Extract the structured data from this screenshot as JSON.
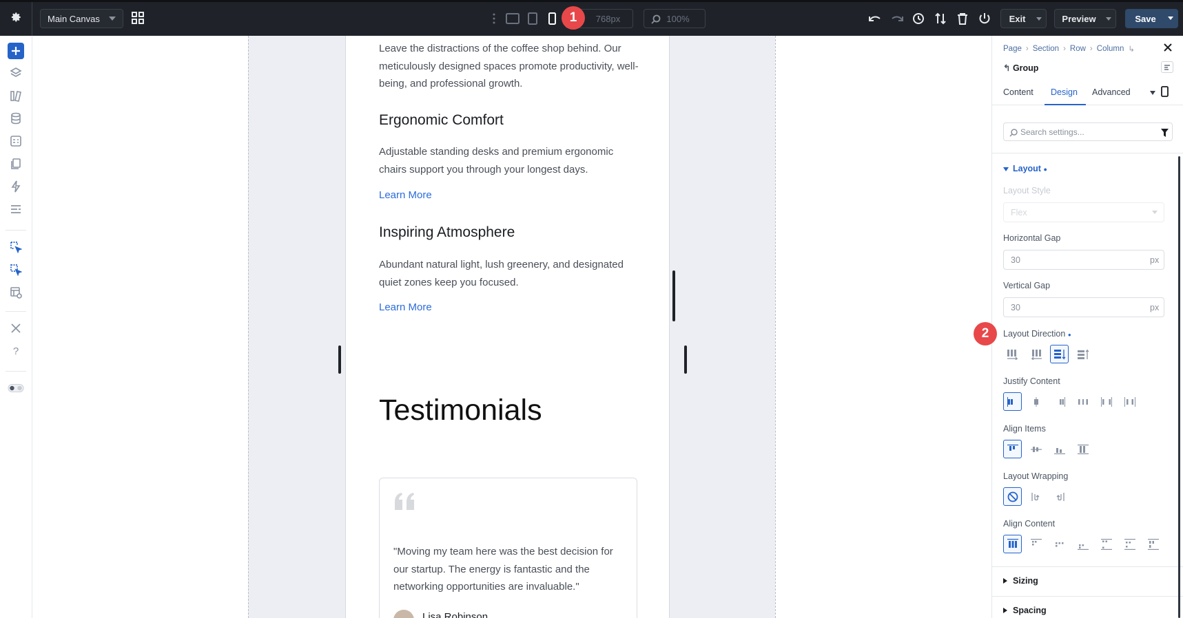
{
  "topbar": {
    "canvas_select": "Main Canvas",
    "width_value": "768px",
    "zoom_value": "100%",
    "exit_label": "Exit",
    "preview_label": "Preview",
    "save_label": "Save",
    "marker_1": "1"
  },
  "content": {
    "intro_text": "Leave the distractions of the coffee shop behind. Our meticulously designed spaces promote productivity, well-being, and professional growth.",
    "feature_1_title": "Ergonomic Comfort",
    "feature_1_text": "Adjustable standing desks and premium ergonomic chairs support you through your longest days.",
    "feature_1_link": "Learn More",
    "feature_2_title": "Inspiring Atmosphere",
    "feature_2_text": "Abundant natural light, lush greenery, and designated quiet zones keep you focused.",
    "feature_2_link": "Learn More",
    "testimonials_heading": "Testimonials",
    "testimonial_quote": "\"Moving my team here was the best decision for our startup. The energy is fantastic and the networking opportunities are invaluable.\"",
    "testimonial_author": "Lisa Robinson"
  },
  "panel": {
    "breadcrumb": [
      "Page",
      "Section",
      "Row",
      "Column"
    ],
    "group_label": "Group",
    "tabs": [
      "Content",
      "Design",
      "Advanced"
    ],
    "active_tab": "Design",
    "search_placeholder": "Search settings...",
    "layout_section": "Layout",
    "layout_style_label": "Layout Style",
    "layout_style_value": "Flex",
    "horizontal_gap_label": "Horizontal Gap",
    "horizontal_gap_value": "30",
    "horizontal_gap_unit": "px",
    "vertical_gap_label": "Vertical Gap",
    "vertical_gap_value": "30",
    "vertical_gap_unit": "px",
    "layout_direction_label": "Layout Direction",
    "justify_content_label": "Justify Content",
    "align_items_label": "Align Items",
    "layout_wrapping_label": "Layout Wrapping",
    "align_content_label": "Align Content",
    "sizing_section": "Sizing",
    "spacing_section": "Spacing",
    "marker_2": "2"
  },
  "colors": {
    "accent": "#2563c9",
    "topbar": "#1f2329",
    "marker": "#e8484a",
    "link": "#2b6cdc"
  }
}
